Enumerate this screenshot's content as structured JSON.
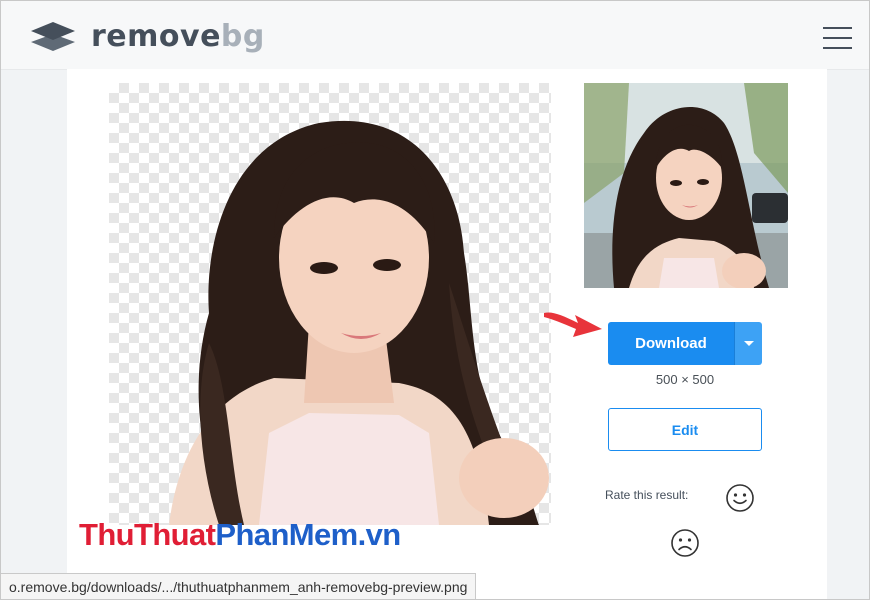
{
  "header": {
    "logo_part1": "remove",
    "logo_part2": "bg",
    "icons": [
      "layers-logo-icon",
      "hamburger-menu-icon"
    ]
  },
  "result": {
    "download_label": "Download",
    "dimensions": "500 × 500",
    "edit_label": "Edit",
    "rate_label": "Rate this result:",
    "icons": [
      "dropdown-caret-icon",
      "smiley-happy-icon",
      "smiley-sad-icon"
    ]
  },
  "watermark": {
    "part1": "ThuThuat",
    "part2": "PhanMem.vn"
  },
  "statusbar": {
    "url": "o.remove.bg/downloads/.../thuthuatphanmem_anh-removebg-preview.png"
  },
  "colors": {
    "accent": "#1a8cf0",
    "logo_dark": "#454f5b",
    "logo_light": "#a8b0b9",
    "annotation_arrow": "#e8343b",
    "watermark_red": "#e01e35",
    "watermark_blue": "#1e5fc9"
  }
}
